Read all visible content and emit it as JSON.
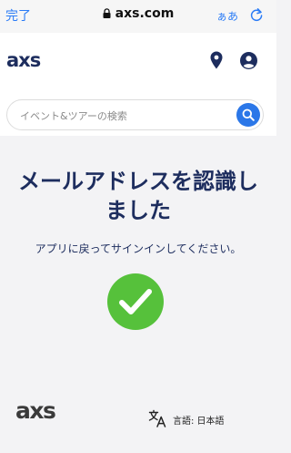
{
  "browser": {
    "done_label": "完了",
    "url": "axs.com",
    "text_size_label": "ぁあ"
  },
  "header": {
    "logo_text": "axs",
    "brand_color": "#1d2d5e"
  },
  "search": {
    "placeholder": "イベント&ツアーの検索",
    "value": "",
    "button_color": "#2b77e8"
  },
  "main": {
    "title": "メールアドレスを認識しました",
    "subtitle": "アプリに戻ってサインインしてください。",
    "success_color": "#56c13b"
  },
  "footer": {
    "logo_text": "axs",
    "language_label": "言語: 日本語"
  },
  "icons": {
    "lock": "lock-icon",
    "reload": "reload-icon",
    "location": "location-pin-icon",
    "account": "account-icon",
    "search": "search-icon",
    "check": "checkmark-icon",
    "translate": "translate-icon"
  }
}
